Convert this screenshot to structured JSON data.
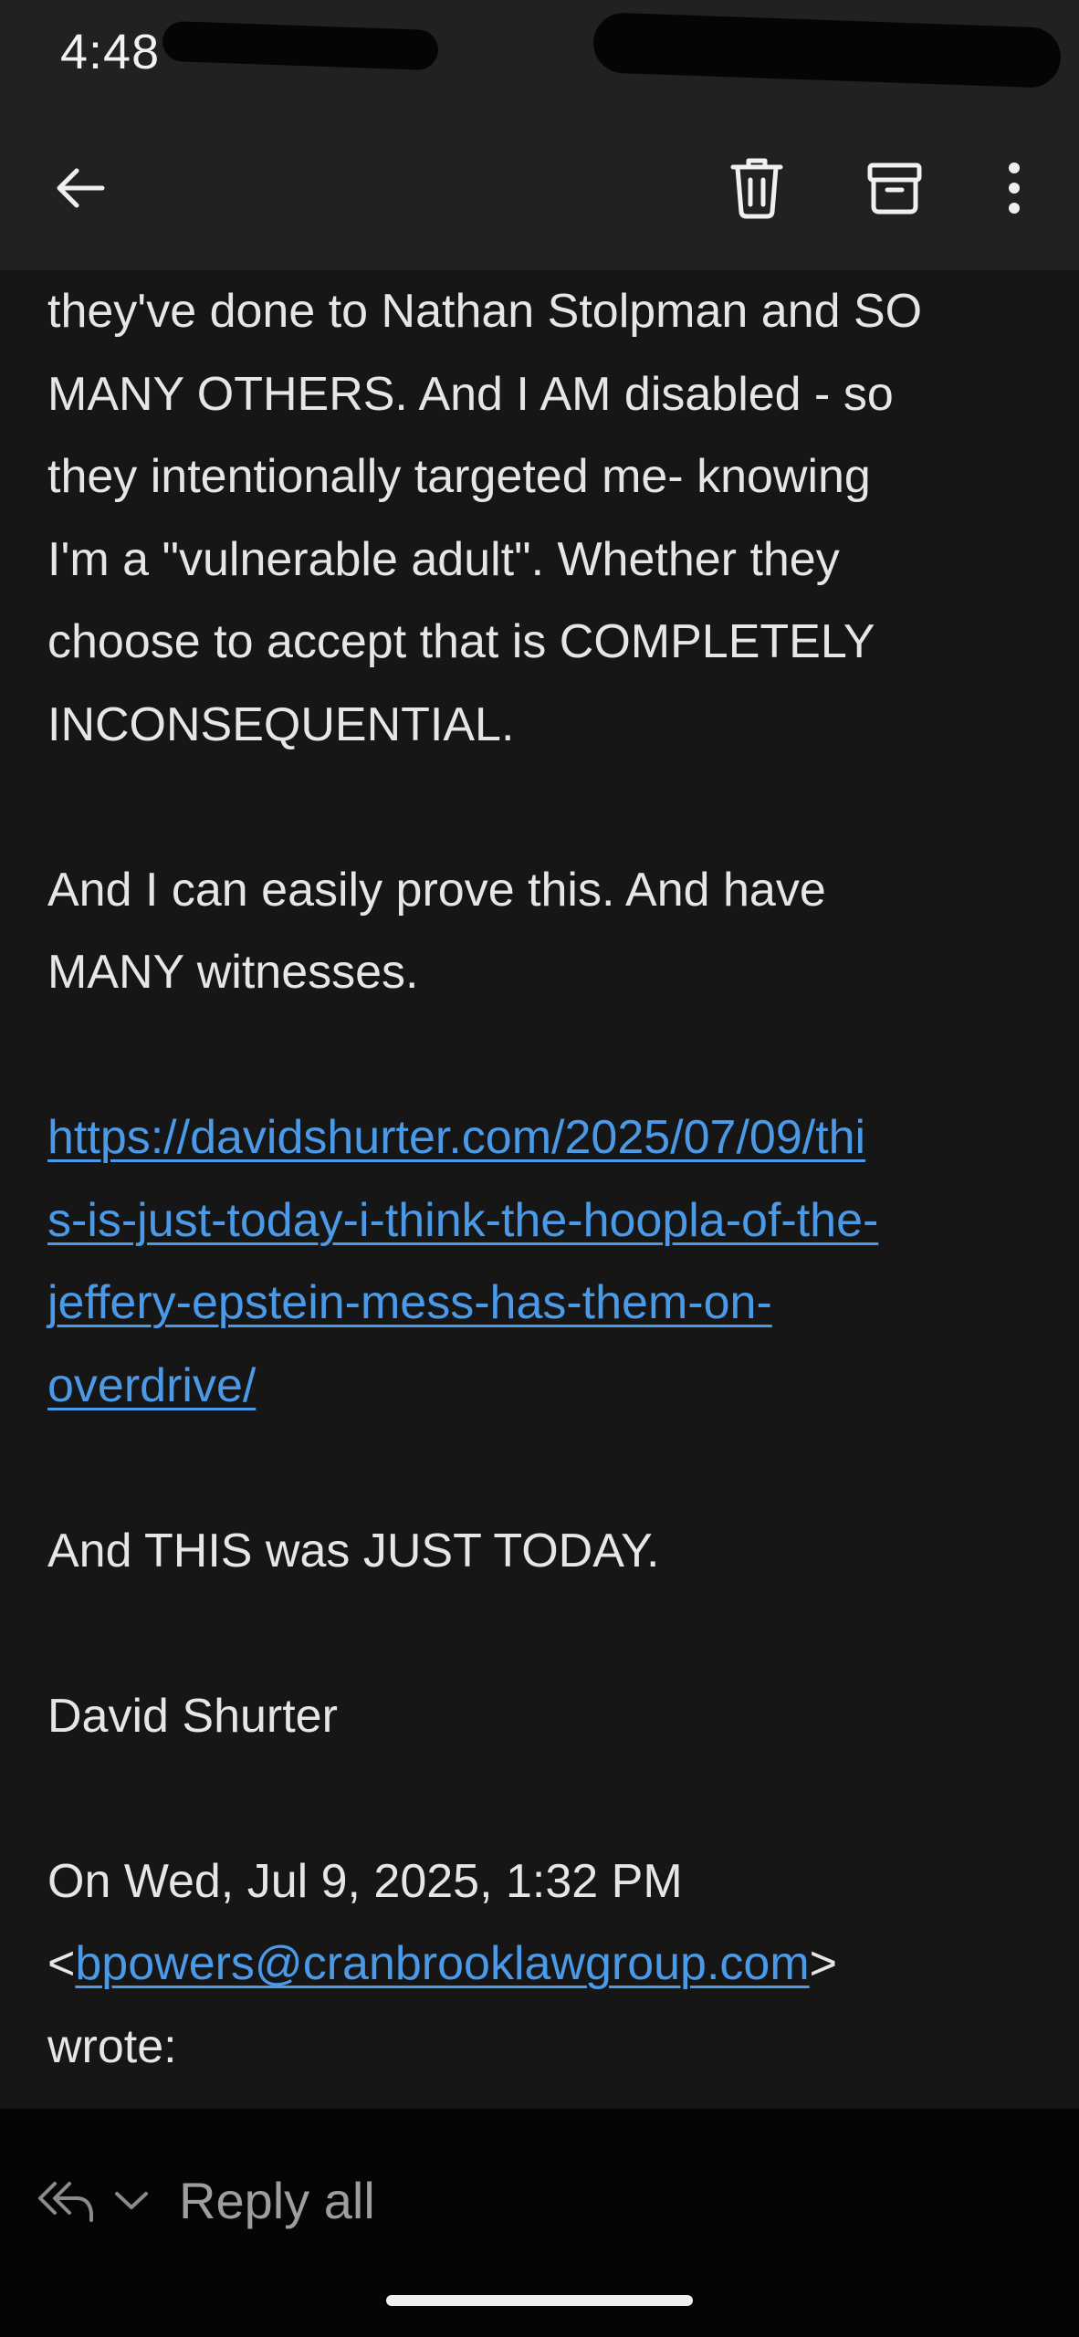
{
  "status_bar": {
    "time": "4:48"
  },
  "toolbar": {
    "back_icon": "arrow-left-icon",
    "delete_icon": "trash-icon",
    "archive_icon": "archive-icon",
    "more_icon": "more-vertical-icon"
  },
  "message": {
    "lines": {
      "l1": "they've done to Nathan Stolpman and SO",
      "l2": "MANY OTHERS. And I AM disabled - so",
      "l3": "they intentionally targeted me- knowing",
      "l4": "I'm a \"vulnerable adult\". Whether they",
      "l5": "choose to accept that is COMPLETELY",
      "l6": "INCONSEQUENTIAL.",
      "l7": "And I can easily prove this. And have",
      "l8": "MANY witnesses.",
      "l9": "And THIS was JUST TODAY.",
      "l10": "David Shurter",
      "l11": "On Wed, Jul 9, 2025, 1:32 PM",
      "l12_open": "<",
      "l12_close": ">",
      "l13": "wrote:"
    },
    "link_lines": {
      "a": "https://davidshurter.com/2025/07/09/thi",
      "b": "s-is-just-today-i-think-the-hoopla-of-the-",
      "c": "jeffery-epstein-mess-has-them-on-",
      "d": "overdrive/"
    },
    "email": "bpowers@cranbrooklawgroup.com"
  },
  "reply_bar": {
    "label": "Reply all",
    "icon": "reply-all-icon",
    "dropdown_icon": "chevron-down-icon"
  },
  "colors": {
    "background": "#161617",
    "toolbar": "#212121",
    "text": "#e6e6e6",
    "link": "#4a9ae8",
    "reply_bar": "#050505",
    "reply_label": "#9e9e9e"
  }
}
